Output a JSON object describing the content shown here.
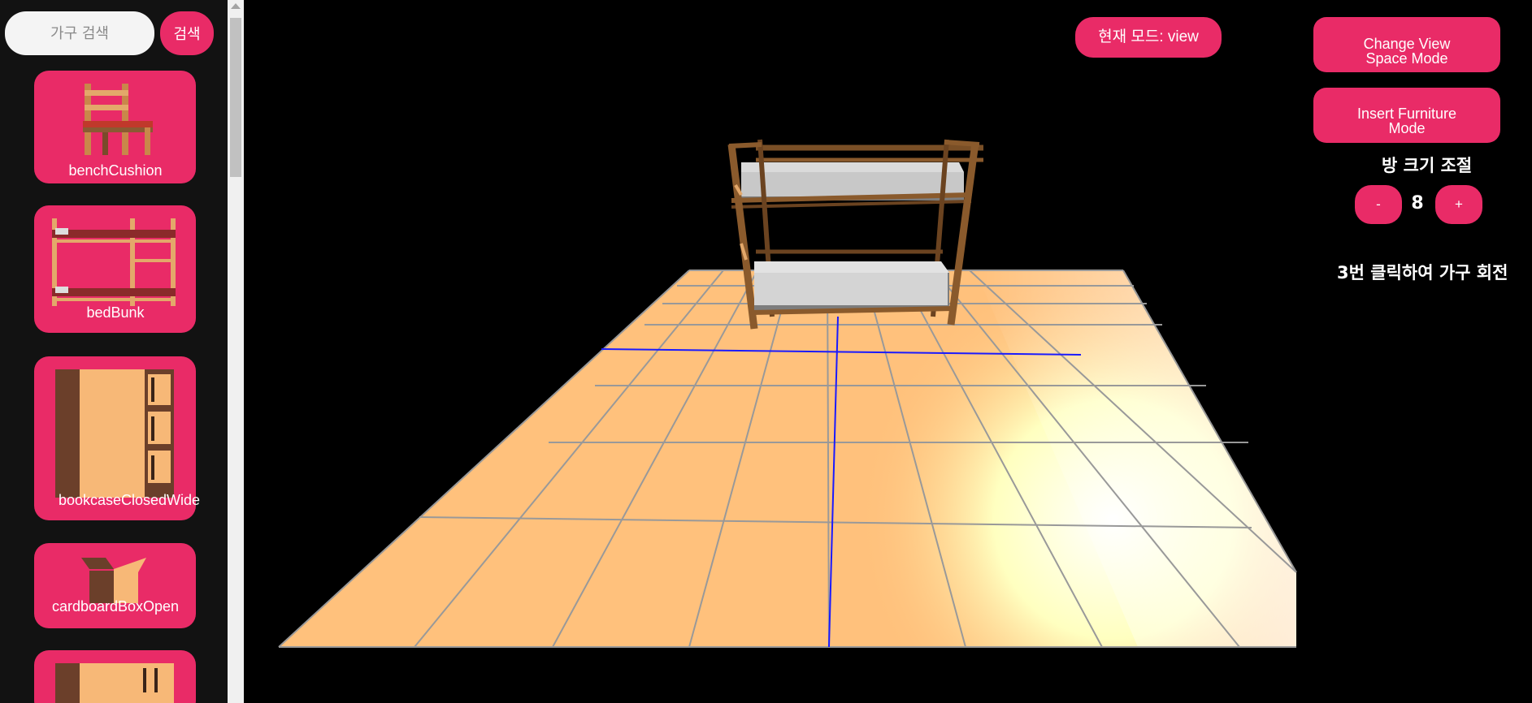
{
  "search": {
    "placeholder": "가구 검색",
    "button_label": "검색"
  },
  "furniture_list": [
    {
      "label": "benchCushion"
    },
    {
      "label": "bedBunk"
    },
    {
      "label": "bookcaseClosedWide"
    },
    {
      "label": "cardboardBoxOpen"
    }
  ],
  "viewport": {
    "mode_label": "현재 모드: view",
    "change_view_label_line1": "Change View",
    "change_view_label_line2": "Space Mode",
    "insert_label_line1": "Insert Furniture",
    "insert_label_line2": "Mode",
    "room_size_title": "방 크기 조절",
    "decrease_label": "-",
    "increase_label": "+",
    "room_size_value": "8",
    "rotate_hint": "3번 클릭하여 가구 회전"
  },
  "colors": {
    "accent": "#e92b67",
    "floor": "#ffc17c",
    "sidebar_bg": "#121212"
  }
}
